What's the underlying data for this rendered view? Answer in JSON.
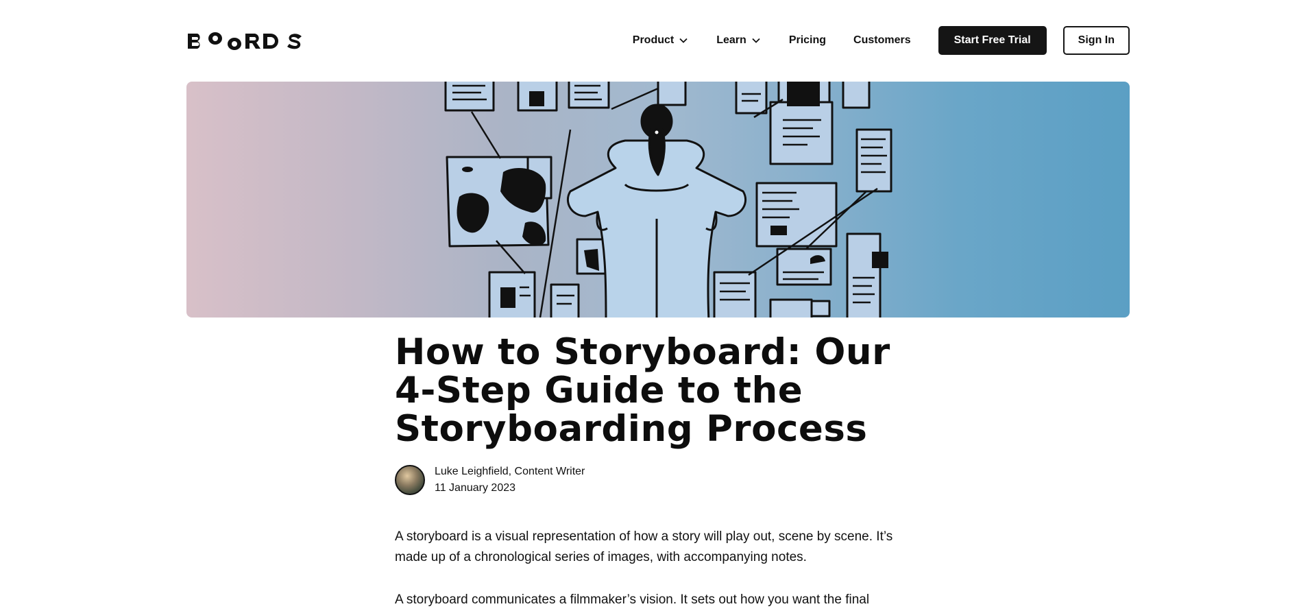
{
  "header": {
    "logo_text": "BOORDS",
    "nav": [
      {
        "label": "Product",
        "has_dropdown": true
      },
      {
        "label": "Learn",
        "has_dropdown": true
      },
      {
        "label": "Pricing",
        "has_dropdown": false
      },
      {
        "label": "Customers",
        "has_dropdown": false
      }
    ],
    "trial_label": "Start Free Trial",
    "signin_label": "Sign In"
  },
  "hero": {
    "icon": "storyboard-illustration",
    "colors": {
      "left": "#d8c0c8",
      "right": "#5b9fc4"
    }
  },
  "article": {
    "title": "How to Storyboard: Our 4-Step Guide to the Storyboarding Process",
    "author": "Luke Leighfield, Content Writer",
    "date": "11 January 2023",
    "paragraphs": [
      "A storyboard is a visual representation of how a story will play out, scene by scene. It’s made up of a chronological series of images, with accompanying notes.",
      "A storyboard communicates a filmmaker’s vision. It sets out how you want the final"
    ]
  }
}
